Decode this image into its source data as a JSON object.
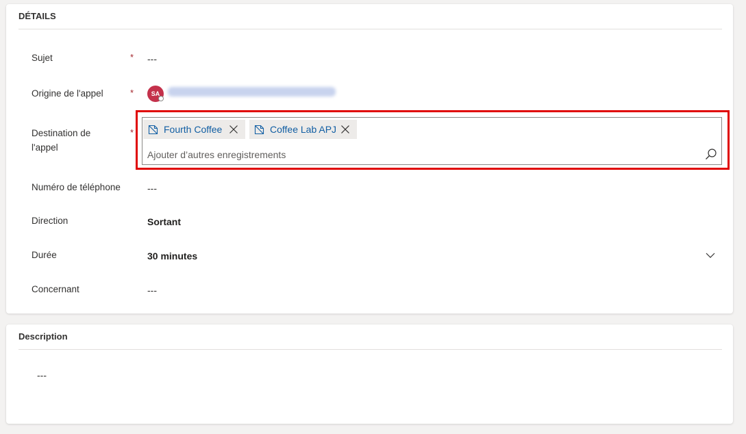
{
  "details": {
    "title": "DÉTAILS",
    "fields": {
      "subject": {
        "label": "Sujet",
        "value": "---",
        "required": "*"
      },
      "call_from": {
        "label": "Origine de l'appel",
        "avatar_initials": "SA",
        "required": "*"
      },
      "call_to": {
        "label_line1": "Destination de",
        "label_line2": "l'appel",
        "required": "*",
        "tags": [
          {
            "label": "Fourth Coffee",
            "icon": "account-icon"
          },
          {
            "label": "Coffee Lab APJ",
            "icon": "account-icon"
          }
        ],
        "placeholder": "Ajouter d’autres enregistrements"
      },
      "phone": {
        "label": "Numéro de téléphone",
        "value": "---"
      },
      "direction": {
        "label": "Direction",
        "value": "Sortant"
      },
      "duration": {
        "label": "Durée",
        "value": "30 minutes"
      },
      "regarding": {
        "label": "Concernant",
        "value": "---"
      }
    }
  },
  "description": {
    "title": "Description",
    "value": "---"
  },
  "colors": {
    "highlight": "#e00000",
    "required": "#a4262c",
    "link": "#115ea3"
  }
}
